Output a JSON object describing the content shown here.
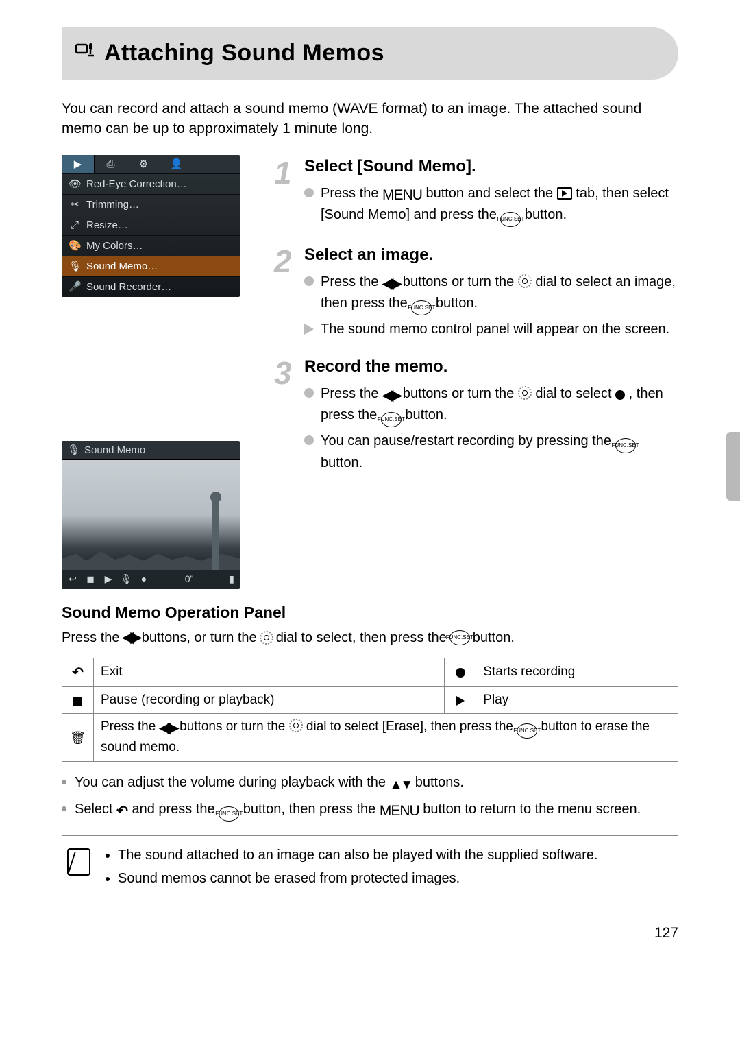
{
  "header": {
    "title": "Attaching Sound Memos"
  },
  "intro": "You can record and attach a sound memo (WAVE format) to an image. The attached sound memo can be up to approximately 1 minute long.",
  "camera_menu": {
    "tabs": [
      "▶",
      "⎙",
      "⚙",
      "👤"
    ],
    "items": [
      {
        "icon": "👁",
        "label": "Red-Eye Correction…"
      },
      {
        "icon": "✂",
        "label": "Trimming…"
      },
      {
        "icon": "⤢",
        "label": "Resize…"
      },
      {
        "icon": "🎨",
        "label": "My Colors…"
      },
      {
        "icon": "🎙",
        "label": "Sound Memo…",
        "highlight": true
      },
      {
        "icon": "🎤",
        "label": "Sound Recorder…"
      }
    ]
  },
  "photo_preview": {
    "title": "Sound Memo",
    "time": "0\"",
    "controls": [
      "↩",
      "◼",
      "▶",
      "🎙",
      "●"
    ]
  },
  "steps": [
    {
      "num": "1",
      "title": "Select [Sound Memo].",
      "bullets": [
        {
          "type": "dot",
          "segs": [
            "Press the ",
            "@MENU",
            " button and select the ",
            "@PLAY",
            " tab, then select [Sound Memo] and press the ",
            "@FUNC",
            " button."
          ]
        }
      ]
    },
    {
      "num": "2",
      "title": "Select an image.",
      "bullets": [
        {
          "type": "dot",
          "segs": [
            "Press the ",
            "@LR",
            " buttons or turn the ",
            "@DIAL",
            " dial to select an image, then press the ",
            "@FUNC",
            " button."
          ]
        },
        {
          "type": "arrow",
          "segs": [
            "The sound memo control panel will appear on the screen."
          ]
        }
      ]
    },
    {
      "num": "3",
      "title": "Record the memo.",
      "bullets": [
        {
          "type": "dot",
          "segs": [
            "Press the ",
            "@LR",
            " buttons or turn the ",
            "@DIAL",
            " dial to select ",
            "@REC",
            " , then press the ",
            "@FUNC",
            " button."
          ]
        },
        {
          "type": "dot",
          "segs": [
            "You can pause/restart recording by pressing the ",
            "@FUNC",
            " button."
          ]
        }
      ]
    }
  ],
  "panel": {
    "heading": "Sound Memo Operation Panel",
    "intro_segs": [
      "Press the ",
      "@LR",
      " buttons, or turn the ",
      "@DIAL",
      " dial to select, then press the ",
      "@FUNC",
      " button."
    ],
    "rows": [
      [
        {
          "icon": "@BACK",
          "text": "Exit"
        },
        {
          "icon": "@REC",
          "text": "Starts recording"
        }
      ],
      [
        {
          "icon": "@STOP",
          "text": "Pause (recording or playback)"
        },
        {
          "icon": "@PLAYTRI",
          "text": "Play"
        }
      ]
    ],
    "erase_row": {
      "icon": "@TRASH",
      "segs": [
        "Press the ",
        "@LR",
        " buttons or turn the ",
        "@DIAL",
        " dial to select [Erase], then press the ",
        "@FUNC",
        " button to erase the sound memo."
      ]
    }
  },
  "tips": [
    {
      "segs": [
        "You can adjust the volume during playback with the ",
        "@UD",
        " buttons."
      ]
    },
    {
      "segs": [
        "Select ",
        "@BACK",
        " and press the ",
        "@FUNC",
        " button, then press the ",
        "@MENU",
        " button to return to the menu screen."
      ]
    }
  ],
  "note": {
    "items": [
      "The sound attached to an image can also be played with the supplied software.",
      "Sound memos cannot be erased from protected images."
    ]
  },
  "page_number": "127",
  "glyph_labels": {
    "MENU": "MENU",
    "FUNC_TOP": "FUNC.",
    "FUNC_BOT": "SET"
  }
}
